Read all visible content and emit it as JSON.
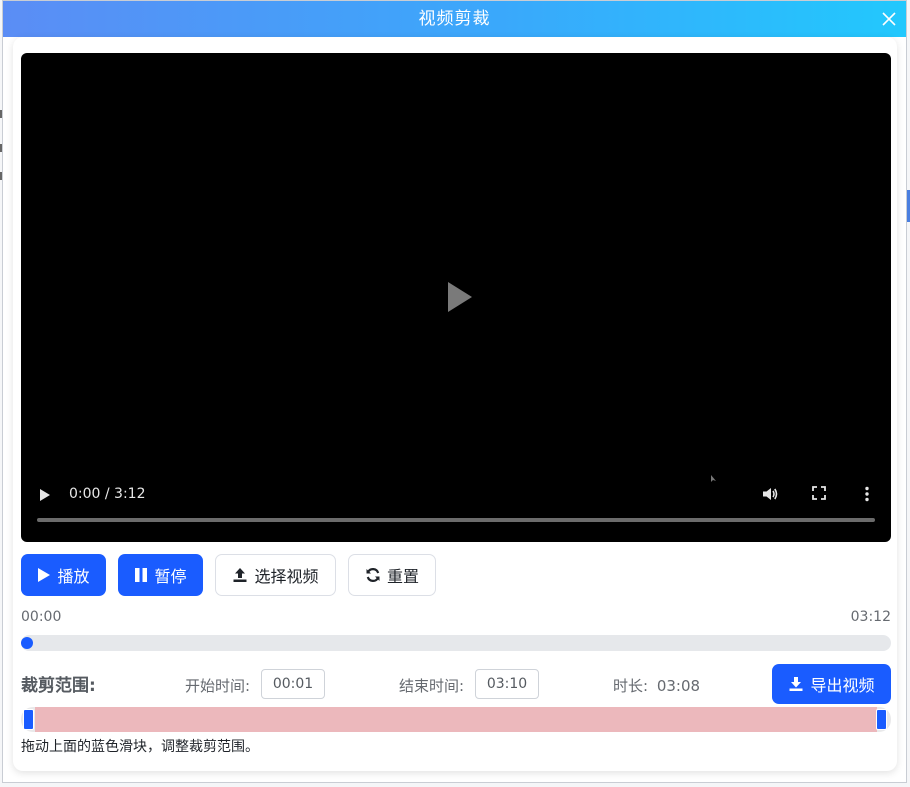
{
  "dialog": {
    "title": "视频剪裁"
  },
  "player": {
    "time_display": "0:00 / 3:12",
    "played_fraction": 0.0
  },
  "buttons": {
    "play": "播放",
    "pause": "暂停",
    "select_video": "选择视频",
    "reset": "重置",
    "export": "导出视频"
  },
  "timeline": {
    "start_label": "00:00",
    "end_label": "03:12",
    "position_fraction": 0.0
  },
  "trim": {
    "title": "裁剪范围:",
    "start_label": "开始时间:",
    "start_value": "00:01",
    "end_label": "结束时间:",
    "end_value": "03:10",
    "duration_label": "时长:",
    "duration_value": "03:08",
    "hint": "拖动上面的蓝色滑块，调整裁剪范围。"
  },
  "colors": {
    "primary": "#1a5cff",
    "selected_range": "#ecb8bc",
    "title_gradient_start": "#5b8df5",
    "title_gradient_end": "#22c8fd"
  }
}
